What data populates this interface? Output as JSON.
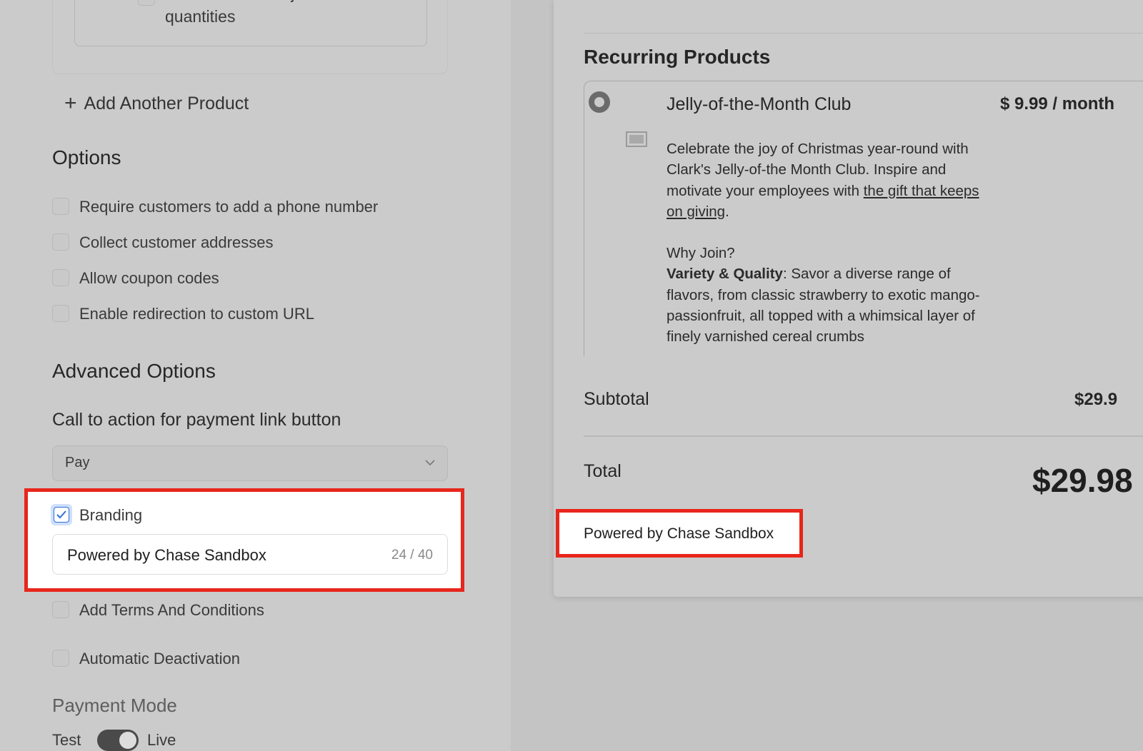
{
  "editor": {
    "product_option_label": "Let customers adjust quantities",
    "add_product_label": "Add Another Product",
    "options_heading": "Options",
    "options": [
      {
        "label": "Require customers to add a phone number",
        "checked": false
      },
      {
        "label": "Collect customer addresses",
        "checked": false
      },
      {
        "label": "Allow coupon codes",
        "checked": false
      },
      {
        "label": "Enable redirection to custom URL",
        "checked": false
      }
    ],
    "advanced_heading": "Advanced Options",
    "cta_label": "Call to action for payment link button",
    "cta_value": "Pay",
    "branding_label": "Branding",
    "branding_checked": true,
    "branding_value": "Powered by Chase Sandbox",
    "branding_count": "24 / 40",
    "terms_label": "Add Terms And Conditions",
    "deactivation_label": "Automatic Deactivation",
    "payment_mode_heading": "Payment Mode",
    "payment_mode_test": "Test",
    "payment_mode_live": "Live"
  },
  "preview": {
    "recurring_heading": "Recurring Products",
    "product_name": "Jelly-of-the-Month Club",
    "product_price": "$ 9.99 / month",
    "desc_p1_a": "Celebrate the joy of Christmas year-round with Clark's Jelly-of-the Month Club. Inspire and motivate your employees with ",
    "desc_p1_link": "the gift that keeps on giving",
    "desc_p1_b": ".",
    "desc_why": "Why Join?",
    "desc_bold": "Variety & Quality",
    "desc_rest": ": Savor a diverse range of flavors, from classic strawberry to exotic mango-passionfruit, all topped with a whimsical layer of finely varnished cereal crumbs",
    "subtotal_label": "Subtotal",
    "subtotal_value": "$29.9",
    "total_label": "Total",
    "total_value": "$29.98",
    "branding_text": "Powered by Chase Sandbox"
  },
  "colors": {
    "highlight": "#e8261c",
    "checkbox_checked": "#2f6fd6"
  }
}
